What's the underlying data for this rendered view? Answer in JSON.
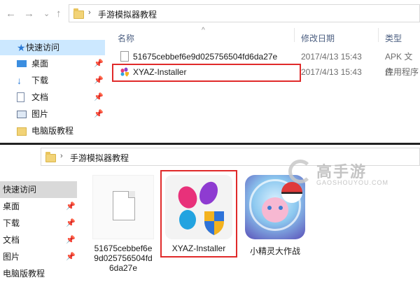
{
  "top": {
    "path": {
      "crumbs": [
        "手游模拟器教程"
      ]
    },
    "columns": {
      "name": "名称",
      "modified": "修改日期",
      "type": "类型"
    },
    "sidebar": [
      {
        "label": "快速访问",
        "icon": "star-icon"
      },
      {
        "label": "桌面",
        "icon": "desktop-icon"
      },
      {
        "label": "下载",
        "icon": "download-icon"
      },
      {
        "label": "文档",
        "icon": "document-icon"
      },
      {
        "label": "图片",
        "icon": "picture-icon"
      },
      {
        "label": "电脑版教程",
        "icon": "folder-icon"
      }
    ],
    "files": [
      {
        "name": "51675cebbef6e9d025756504fd6da27e",
        "date": "2017/4/13 15:43",
        "type": "APK 文件"
      },
      {
        "name": "XYAZ-Installer",
        "date": "2017/4/13 15:43",
        "type": "应用程序"
      }
    ]
  },
  "bottom": {
    "path": {
      "crumbs": [
        "手游模拟器教程"
      ]
    },
    "sidebar": [
      {
        "label": "快速访问"
      },
      {
        "label": "桌面"
      },
      {
        "label": "下载"
      },
      {
        "label": "文档"
      },
      {
        "label": "图片"
      },
      {
        "label": "电脑版教程"
      }
    ],
    "tiles": [
      {
        "label_lines": [
          "51675cebbef6e",
          "9d025756504fd",
          "6da27e"
        ]
      },
      {
        "label_lines": [
          "XYAZ-Installer"
        ]
      },
      {
        "label_lines": [
          "小精灵大作战"
        ]
      }
    ]
  },
  "watermark": {
    "brand": "高手游",
    "domain": "GAOSHOUYOU.COM"
  },
  "colors": {
    "highlight_red": "#e02a2a",
    "selected_bg": "#cce8ff",
    "folder": "#f2d377"
  }
}
